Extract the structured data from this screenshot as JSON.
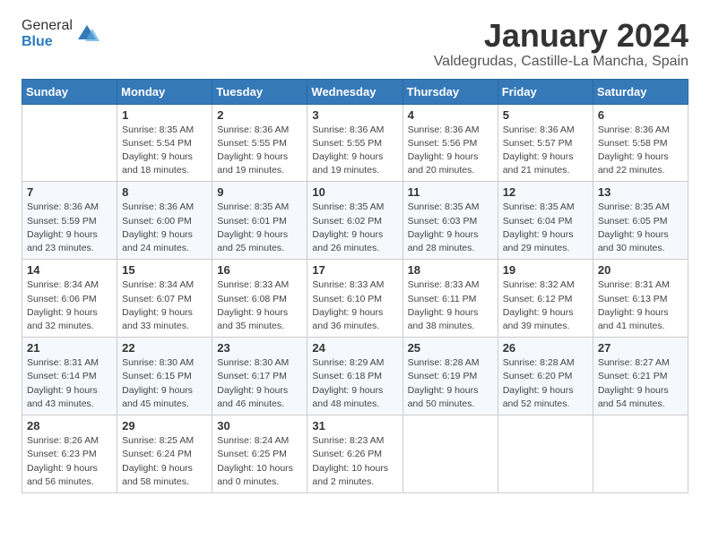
{
  "header": {
    "logo_general": "General",
    "logo_blue": "Blue",
    "month": "January 2024",
    "location": "Valdegrudas, Castille-La Mancha, Spain"
  },
  "weekdays": [
    "Sunday",
    "Monday",
    "Tuesday",
    "Wednesday",
    "Thursday",
    "Friday",
    "Saturday"
  ],
  "weeks": [
    [
      {
        "day": "",
        "info": ""
      },
      {
        "day": "1",
        "info": "Sunrise: 8:35 AM\nSunset: 5:54 PM\nDaylight: 9 hours\nand 18 minutes."
      },
      {
        "day": "2",
        "info": "Sunrise: 8:36 AM\nSunset: 5:55 PM\nDaylight: 9 hours\nand 19 minutes."
      },
      {
        "day": "3",
        "info": "Sunrise: 8:36 AM\nSunset: 5:55 PM\nDaylight: 9 hours\nand 19 minutes."
      },
      {
        "day": "4",
        "info": "Sunrise: 8:36 AM\nSunset: 5:56 PM\nDaylight: 9 hours\nand 20 minutes."
      },
      {
        "day": "5",
        "info": "Sunrise: 8:36 AM\nSunset: 5:57 PM\nDaylight: 9 hours\nand 21 minutes."
      },
      {
        "day": "6",
        "info": "Sunrise: 8:36 AM\nSunset: 5:58 PM\nDaylight: 9 hours\nand 22 minutes."
      }
    ],
    [
      {
        "day": "7",
        "info": "Sunrise: 8:36 AM\nSunset: 5:59 PM\nDaylight: 9 hours\nand 23 minutes."
      },
      {
        "day": "8",
        "info": "Sunrise: 8:36 AM\nSunset: 6:00 PM\nDaylight: 9 hours\nand 24 minutes."
      },
      {
        "day": "9",
        "info": "Sunrise: 8:35 AM\nSunset: 6:01 PM\nDaylight: 9 hours\nand 25 minutes."
      },
      {
        "day": "10",
        "info": "Sunrise: 8:35 AM\nSunset: 6:02 PM\nDaylight: 9 hours\nand 26 minutes."
      },
      {
        "day": "11",
        "info": "Sunrise: 8:35 AM\nSunset: 6:03 PM\nDaylight: 9 hours\nand 28 minutes."
      },
      {
        "day": "12",
        "info": "Sunrise: 8:35 AM\nSunset: 6:04 PM\nDaylight: 9 hours\nand 29 minutes."
      },
      {
        "day": "13",
        "info": "Sunrise: 8:35 AM\nSunset: 6:05 PM\nDaylight: 9 hours\nand 30 minutes."
      }
    ],
    [
      {
        "day": "14",
        "info": "Sunrise: 8:34 AM\nSunset: 6:06 PM\nDaylight: 9 hours\nand 32 minutes."
      },
      {
        "day": "15",
        "info": "Sunrise: 8:34 AM\nSunset: 6:07 PM\nDaylight: 9 hours\nand 33 minutes."
      },
      {
        "day": "16",
        "info": "Sunrise: 8:33 AM\nSunset: 6:08 PM\nDaylight: 9 hours\nand 35 minutes."
      },
      {
        "day": "17",
        "info": "Sunrise: 8:33 AM\nSunset: 6:10 PM\nDaylight: 9 hours\nand 36 minutes."
      },
      {
        "day": "18",
        "info": "Sunrise: 8:33 AM\nSunset: 6:11 PM\nDaylight: 9 hours\nand 38 minutes."
      },
      {
        "day": "19",
        "info": "Sunrise: 8:32 AM\nSunset: 6:12 PM\nDaylight: 9 hours\nand 39 minutes."
      },
      {
        "day": "20",
        "info": "Sunrise: 8:31 AM\nSunset: 6:13 PM\nDaylight: 9 hours\nand 41 minutes."
      }
    ],
    [
      {
        "day": "21",
        "info": "Sunrise: 8:31 AM\nSunset: 6:14 PM\nDaylight: 9 hours\nand 43 minutes."
      },
      {
        "day": "22",
        "info": "Sunrise: 8:30 AM\nSunset: 6:15 PM\nDaylight: 9 hours\nand 45 minutes."
      },
      {
        "day": "23",
        "info": "Sunrise: 8:30 AM\nSunset: 6:17 PM\nDaylight: 9 hours\nand 46 minutes."
      },
      {
        "day": "24",
        "info": "Sunrise: 8:29 AM\nSunset: 6:18 PM\nDaylight: 9 hours\nand 48 minutes."
      },
      {
        "day": "25",
        "info": "Sunrise: 8:28 AM\nSunset: 6:19 PM\nDaylight: 9 hours\nand 50 minutes."
      },
      {
        "day": "26",
        "info": "Sunrise: 8:28 AM\nSunset: 6:20 PM\nDaylight: 9 hours\nand 52 minutes."
      },
      {
        "day": "27",
        "info": "Sunrise: 8:27 AM\nSunset: 6:21 PM\nDaylight: 9 hours\nand 54 minutes."
      }
    ],
    [
      {
        "day": "28",
        "info": "Sunrise: 8:26 AM\nSunset: 6:23 PM\nDaylight: 9 hours\nand 56 minutes."
      },
      {
        "day": "29",
        "info": "Sunrise: 8:25 AM\nSunset: 6:24 PM\nDaylight: 9 hours\nand 58 minutes."
      },
      {
        "day": "30",
        "info": "Sunrise: 8:24 AM\nSunset: 6:25 PM\nDaylight: 10 hours\nand 0 minutes."
      },
      {
        "day": "31",
        "info": "Sunrise: 8:23 AM\nSunset: 6:26 PM\nDaylight: 10 hours\nand 2 minutes."
      },
      {
        "day": "",
        "info": ""
      },
      {
        "day": "",
        "info": ""
      },
      {
        "day": "",
        "info": ""
      }
    ]
  ]
}
